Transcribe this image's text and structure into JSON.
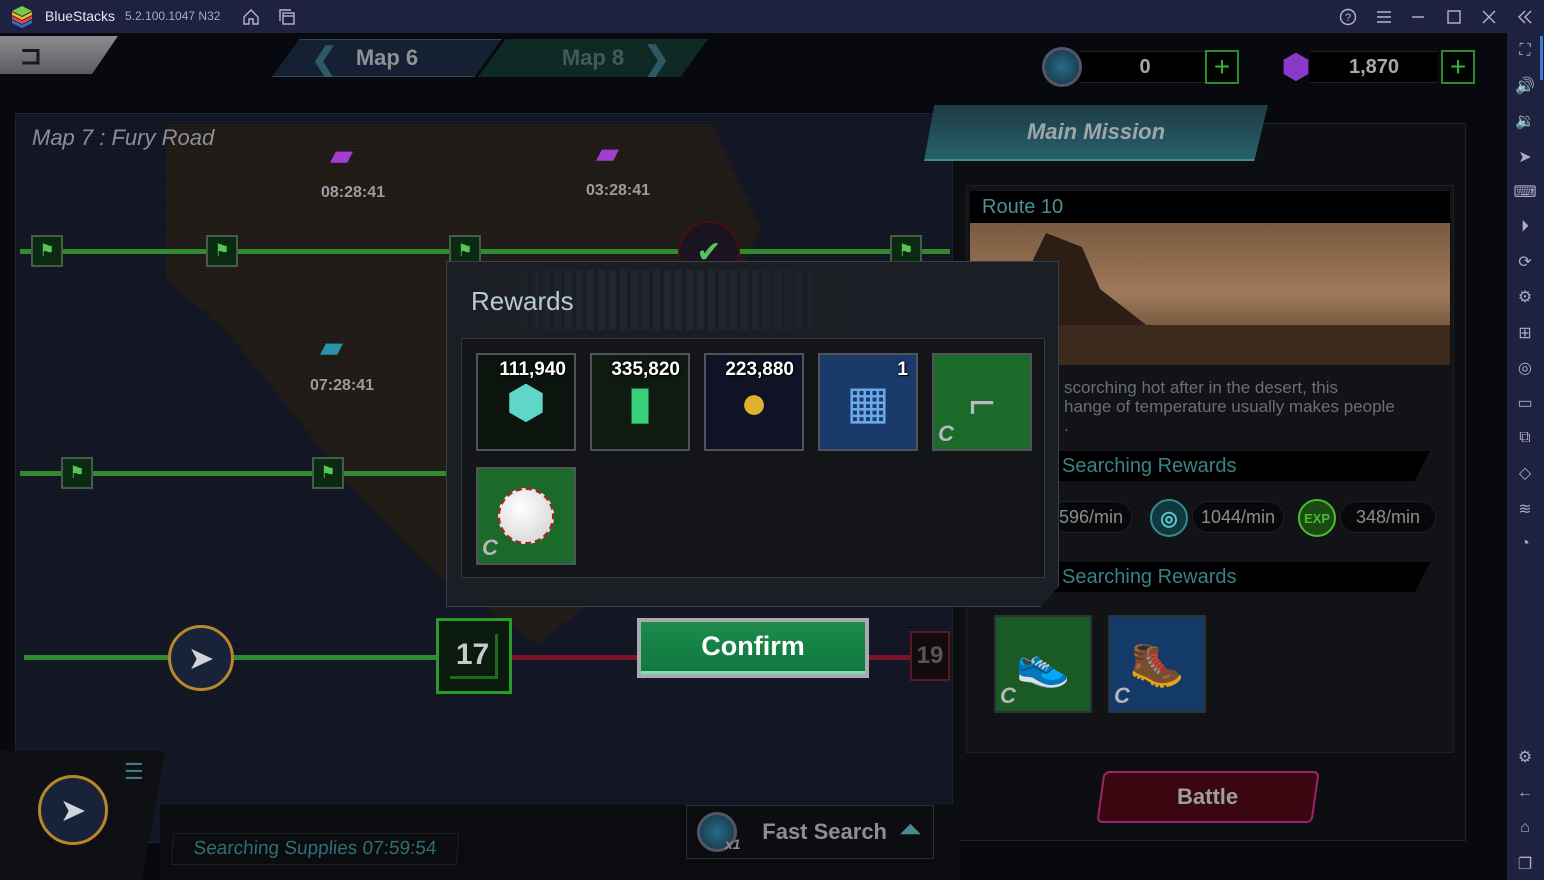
{
  "app": {
    "name": "BlueStacks",
    "version": "5.2.100.1047 N32",
    "titlebar_icons": [
      "home-icon",
      "multi-instance-icon"
    ],
    "window_controls": [
      "help-icon",
      "menu-icon",
      "minimize-icon",
      "maximize-icon",
      "close-icon",
      "collapse-sidebar-icon"
    ]
  },
  "sidebar": {
    "items": [
      {
        "name": "fullscreen-icon",
        "glyph": "⛶"
      },
      {
        "name": "volume-up-icon",
        "glyph": "🔊"
      },
      {
        "name": "volume-down-icon",
        "glyph": "🔉"
      },
      {
        "name": "pointer-icon",
        "glyph": "➤"
      },
      {
        "name": "keyboard-icon",
        "glyph": "⌨"
      },
      {
        "name": "record-icon",
        "glyph": "⏵"
      },
      {
        "name": "rotate-icon",
        "glyph": "⟳"
      },
      {
        "name": "macro-icon",
        "glyph": "⚙"
      },
      {
        "name": "install-apk-icon",
        "glyph": "⊞"
      },
      {
        "name": "screenshot-icon",
        "glyph": "◎"
      },
      {
        "name": "folder-icon",
        "glyph": "▭"
      },
      {
        "name": "resize-icon",
        "glyph": "⧉"
      },
      {
        "name": "shake-icon",
        "glyph": "◇"
      },
      {
        "name": "layers-icon",
        "glyph": "≋"
      },
      {
        "name": "speed-icon",
        "glyph": "◔"
      }
    ],
    "bottom_items": [
      {
        "name": "settings-icon",
        "glyph": "⚙"
      },
      {
        "name": "back-icon",
        "glyph": "←"
      },
      {
        "name": "home-icon",
        "glyph": "⌂"
      },
      {
        "name": "recent-apps-icon",
        "glyph": "❐"
      }
    ]
  },
  "top_nav": {
    "prev_map": "Map 6",
    "next_map": "Map 8"
  },
  "resources": {
    "tickets": "0",
    "gems": "1,870"
  },
  "map": {
    "title": "Map 7 : Fury Road",
    "timers": [
      "08:28:41",
      "03:28:41",
      "07:28:41"
    ],
    "current_node": "17",
    "next_node": "19"
  },
  "rewards_dialog": {
    "title": "Rewards",
    "items": [
      {
        "name": "reward-chip",
        "qty": "111,940",
        "icon": "⬢",
        "bg": "#0c140e"
      },
      {
        "name": "reward-canister",
        "qty": "335,820",
        "icon": "🧪",
        "bg": "#0f1a11"
      },
      {
        "name": "reward-coins",
        "qty": "223,880",
        "icon": "🪙",
        "bg": "#101226"
      },
      {
        "name": "reward-blueprint",
        "qty": "1",
        "icon": "📘",
        "bg": "#1a3a6a"
      },
      {
        "name": "reward-revolver",
        "qty": "",
        "icon": "🔫",
        "bg": "#1b6a2a",
        "grade": "C"
      },
      {
        "name": "reward-ball",
        "qty": "",
        "icon": "⚾",
        "bg": "#1b6a2a",
        "grade": "C"
      }
    ],
    "confirm_label": "Confirm"
  },
  "mission": {
    "tab_label": "Main Mission",
    "route": "Route 10",
    "description_line1": "scorching hot after in the desert, this",
    "description_line2": "hange of temperature usually makes people",
    "description_line3": ".",
    "searching_rewards_label": "Searching Rewards",
    "rates": [
      "596/min",
      "1044/min",
      "348/min"
    ],
    "rate_icon_exp": "EXP",
    "possible_rewards_label": "Searching Rewards",
    "possible_items": [
      {
        "name": "reward-sneaker",
        "icon": "👟",
        "bg": "#1a5a24",
        "grade": "C"
      },
      {
        "name": "reward-boot",
        "icon": "🥾",
        "bg": "#143a6a",
        "grade": "C"
      }
    ],
    "battle_label": "Battle"
  },
  "bottom": {
    "search_status": "Searching Supplies 07:59:54",
    "fast_search_label": "Fast Search",
    "fast_search_count": "x1"
  }
}
